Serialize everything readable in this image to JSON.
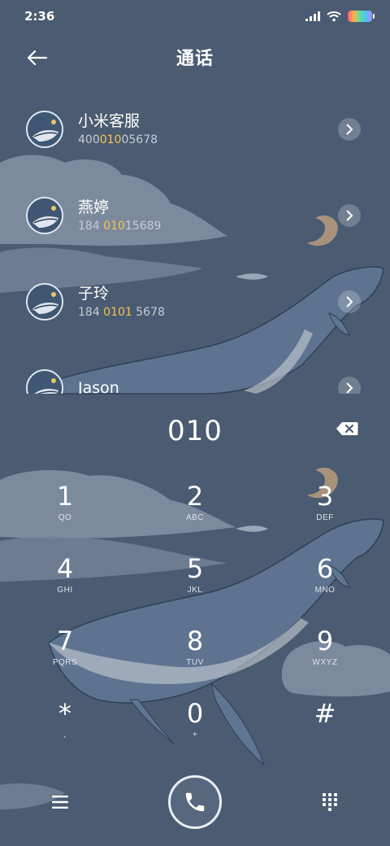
{
  "status_bar": {
    "time": "2:36",
    "icons": [
      "signal-icon",
      "wifi-icon",
      "battery-icon"
    ]
  },
  "header": {
    "title": "通话",
    "back_icon": "arrow-left-icon"
  },
  "contacts": [
    {
      "name": "小米客服",
      "number_pre": "400",
      "number_match": "010",
      "number_post": "05678"
    },
    {
      "name": "燕婷",
      "number_pre": "184 ",
      "number_match": "010",
      "number_post": "15689"
    },
    {
      "name": "子玲",
      "number_pre": "184 ",
      "number_match": "0101",
      "number_post": " 5678"
    },
    {
      "name": "Jason",
      "number_pre": "",
      "number_match": "",
      "number_post": ""
    }
  ],
  "dialer": {
    "input_value": "010",
    "backspace_icon": "backspace-icon"
  },
  "keypad": [
    {
      "digit": "1",
      "letters": "QO"
    },
    {
      "digit": "2",
      "letters": "ABC"
    },
    {
      "digit": "3",
      "letters": "DEF"
    },
    {
      "digit": "4",
      "letters": "GHI"
    },
    {
      "digit": "5",
      "letters": "JKL"
    },
    {
      "digit": "6",
      "letters": "MNO"
    },
    {
      "digit": "7",
      "letters": "PQRS"
    },
    {
      "digit": "8",
      "letters": "TUV"
    },
    {
      "digit": "9",
      "letters": "WXYZ"
    },
    {
      "digit": "*",
      "letters": ","
    },
    {
      "digit": "0",
      "letters": "+"
    },
    {
      "digit": "#",
      "letters": ""
    }
  ],
  "bottom_bar": {
    "menu_icon": "hamburger-menu-icon",
    "call_icon": "phone-icon",
    "keypad_icon": "dialpad-icon"
  },
  "colors": {
    "background": "#4b5b71",
    "highlight": "#f5c453",
    "text_secondary": "#c4ccd6"
  }
}
